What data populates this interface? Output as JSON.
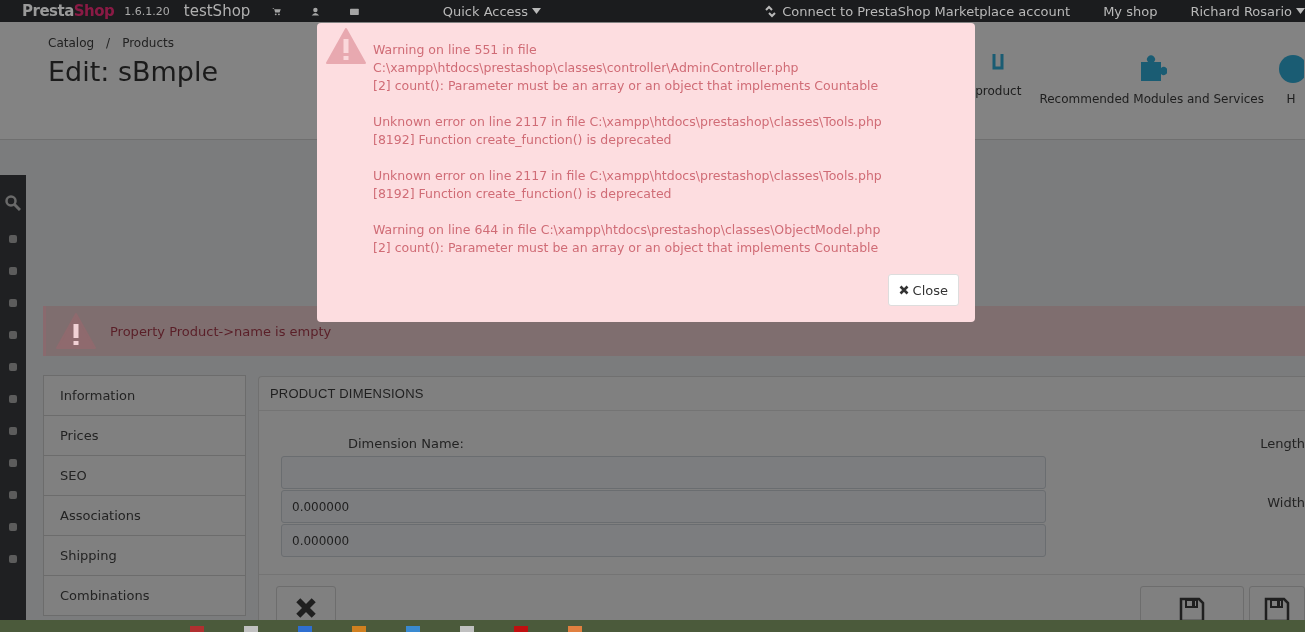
{
  "topbar": {
    "logo": {
      "text": "Presta",
      "accent": "Shop"
    },
    "version": "1.6.1.20",
    "shop": "testShop",
    "quick_access": "Quick Access",
    "marketplace": "Connect to PrestaShop Marketplace account",
    "my_shop": "My shop",
    "user": "Richard Rosario"
  },
  "header": {
    "breadcrumb": [
      "Catalog",
      "Products"
    ],
    "separator": "/",
    "title": "Edit: sBmple",
    "toolbar": [
      {
        "kind": "product",
        "label": "product"
      },
      {
        "kind": "modules",
        "label": "Recommended Modules and Services"
      },
      {
        "kind": "help",
        "label": "H"
      }
    ]
  },
  "alert": {
    "text": "Property Product->name is empty"
  },
  "tabs": [
    {
      "label": "Information",
      "selected": false
    },
    {
      "label": "Prices",
      "selected": false
    },
    {
      "label": "SEO",
      "selected": false
    },
    {
      "label": "Associations",
      "selected": false
    },
    {
      "label": "Shipping",
      "selected": false
    },
    {
      "label": "Combinations",
      "selected": false
    }
  ],
  "panel": {
    "title": "PRODUCT DIMENSIONS",
    "label": "Dimension Name:",
    "fields": [
      {
        "kind": "text"
      },
      {
        "kind": "text",
        "value": "0.000000"
      },
      {
        "kind": "text",
        "value": "0.000000"
      }
    ],
    "side_labels": [
      "Length",
      "Width"
    ]
  },
  "modal": {
    "messages": [
      {
        "lines": [
          "Warning on line 551 in file",
          "C:\\xampp\\htdocs\\prestashop\\classes\\controller\\AdminController.php",
          "[2] count(): Parameter must be an array or an object that implements Countable"
        ]
      },
      {
        "lines": [
          "Unknown error on line 2117 in file C:\\xampp\\htdocs\\prestashop\\classes\\Tools.php",
          "[8192] Function create_function() is deprecated"
        ]
      },
      {
        "lines": [
          "Unknown error on line 2117 in file C:\\xampp\\htdocs\\prestashop\\classes\\Tools.php",
          "[8192] Function create_function() is deprecated"
        ]
      },
      {
        "lines": [
          "Warning on line 644 in file C:\\xampp\\htdocs\\prestashop\\classes\\ObjectModel.php",
          "[2] count(): Parameter must be an array or an object that implements Countable"
        ]
      }
    ],
    "close": "Close"
  }
}
